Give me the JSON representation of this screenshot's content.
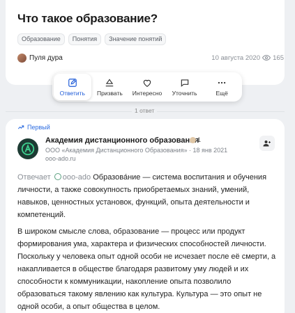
{
  "question": {
    "title": "Что такое образование?",
    "tags": [
      "Образование",
      "Понятия",
      "Значение понятий"
    ],
    "author": "Пуля дура",
    "date": "10 августа 2020",
    "views": "165"
  },
  "actions": [
    {
      "label": "Ответить",
      "icon": "pencil-icon"
    },
    {
      "label": "Призвать",
      "icon": "call-icon"
    },
    {
      "label": "Интересно",
      "icon": "heart-icon"
    },
    {
      "label": "Уточнить",
      "icon": "comment-icon"
    },
    {
      "label": "Ещё",
      "icon": "more-icon"
    }
  ],
  "answers_count": "1 ответ",
  "answer": {
    "badge": "Первый",
    "org_name": "Академия дистанционного образования",
    "org_points": "1",
    "org_full": "ООО «Академия Дистанционного Образования» · 18 янв 2021",
    "org_site": "ooo-ado.ru",
    "answered_label": "Отвечает",
    "handle": "ooo-ado",
    "p1": "Образова́ние — система воспитания и обучения личности, а также совокупность приобретаемых знаний, умений, навыков, ценностных установок, функций, опыта деятельности и компетенций.",
    "p2": "В широком смысле слова, образование — процесс или продукт формирования ума, характера и физических способностей личности. Поскольку у человека опыт одной особи не исчезает после её смерти, а накапливается в обществе благодаря развитому уму людей и их способности к коммуникации, накопление опыта позволило образоваться такому явлению как культура. Культура — это опыт не одной особи, а опыт общества в целом."
  }
}
